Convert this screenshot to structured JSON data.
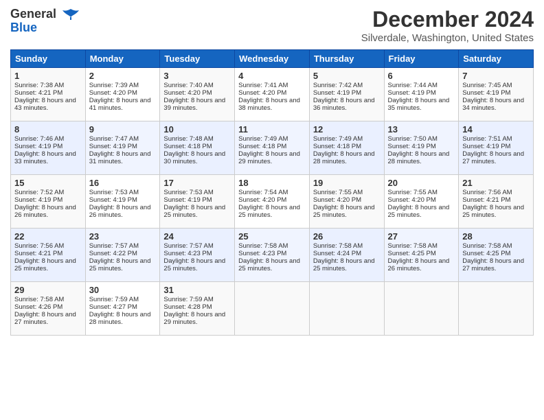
{
  "header": {
    "logo_line1": "General",
    "logo_line2": "Blue",
    "month": "December 2024",
    "location": "Silverdale, Washington, United States"
  },
  "days_of_week": [
    "Sunday",
    "Monday",
    "Tuesday",
    "Wednesday",
    "Thursday",
    "Friday",
    "Saturday"
  ],
  "weeks": [
    [
      {
        "day": "1",
        "sunrise": "Sunrise: 7:38 AM",
        "sunset": "Sunset: 4:21 PM",
        "daylight": "Daylight: 8 hours and 43 minutes."
      },
      {
        "day": "2",
        "sunrise": "Sunrise: 7:39 AM",
        "sunset": "Sunset: 4:20 PM",
        "daylight": "Daylight: 8 hours and 41 minutes."
      },
      {
        "day": "3",
        "sunrise": "Sunrise: 7:40 AM",
        "sunset": "Sunset: 4:20 PM",
        "daylight": "Daylight: 8 hours and 39 minutes."
      },
      {
        "day": "4",
        "sunrise": "Sunrise: 7:41 AM",
        "sunset": "Sunset: 4:20 PM",
        "daylight": "Daylight: 8 hours and 38 minutes."
      },
      {
        "day": "5",
        "sunrise": "Sunrise: 7:42 AM",
        "sunset": "Sunset: 4:19 PM",
        "daylight": "Daylight: 8 hours and 36 minutes."
      },
      {
        "day": "6",
        "sunrise": "Sunrise: 7:44 AM",
        "sunset": "Sunset: 4:19 PM",
        "daylight": "Daylight: 8 hours and 35 minutes."
      },
      {
        "day": "7",
        "sunrise": "Sunrise: 7:45 AM",
        "sunset": "Sunset: 4:19 PM",
        "daylight": "Daylight: 8 hours and 34 minutes."
      }
    ],
    [
      {
        "day": "8",
        "sunrise": "Sunrise: 7:46 AM",
        "sunset": "Sunset: 4:19 PM",
        "daylight": "Daylight: 8 hours and 33 minutes."
      },
      {
        "day": "9",
        "sunrise": "Sunrise: 7:47 AM",
        "sunset": "Sunset: 4:19 PM",
        "daylight": "Daylight: 8 hours and 31 minutes."
      },
      {
        "day": "10",
        "sunrise": "Sunrise: 7:48 AM",
        "sunset": "Sunset: 4:18 PM",
        "daylight": "Daylight: 8 hours and 30 minutes."
      },
      {
        "day": "11",
        "sunrise": "Sunrise: 7:49 AM",
        "sunset": "Sunset: 4:18 PM",
        "daylight": "Daylight: 8 hours and 29 minutes."
      },
      {
        "day": "12",
        "sunrise": "Sunrise: 7:49 AM",
        "sunset": "Sunset: 4:18 PM",
        "daylight": "Daylight: 8 hours and 28 minutes."
      },
      {
        "day": "13",
        "sunrise": "Sunrise: 7:50 AM",
        "sunset": "Sunset: 4:19 PM",
        "daylight": "Daylight: 8 hours and 28 minutes."
      },
      {
        "day": "14",
        "sunrise": "Sunrise: 7:51 AM",
        "sunset": "Sunset: 4:19 PM",
        "daylight": "Daylight: 8 hours and 27 minutes."
      }
    ],
    [
      {
        "day": "15",
        "sunrise": "Sunrise: 7:52 AM",
        "sunset": "Sunset: 4:19 PM",
        "daylight": "Daylight: 8 hours and 26 minutes."
      },
      {
        "day": "16",
        "sunrise": "Sunrise: 7:53 AM",
        "sunset": "Sunset: 4:19 PM",
        "daylight": "Daylight: 8 hours and 26 minutes."
      },
      {
        "day": "17",
        "sunrise": "Sunrise: 7:53 AM",
        "sunset": "Sunset: 4:19 PM",
        "daylight": "Daylight: 8 hours and 25 minutes."
      },
      {
        "day": "18",
        "sunrise": "Sunrise: 7:54 AM",
        "sunset": "Sunset: 4:20 PM",
        "daylight": "Daylight: 8 hours and 25 minutes."
      },
      {
        "day": "19",
        "sunrise": "Sunrise: 7:55 AM",
        "sunset": "Sunset: 4:20 PM",
        "daylight": "Daylight: 8 hours and 25 minutes."
      },
      {
        "day": "20",
        "sunrise": "Sunrise: 7:55 AM",
        "sunset": "Sunset: 4:20 PM",
        "daylight": "Daylight: 8 hours and 25 minutes."
      },
      {
        "day": "21",
        "sunrise": "Sunrise: 7:56 AM",
        "sunset": "Sunset: 4:21 PM",
        "daylight": "Daylight: 8 hours and 25 minutes."
      }
    ],
    [
      {
        "day": "22",
        "sunrise": "Sunrise: 7:56 AM",
        "sunset": "Sunset: 4:21 PM",
        "daylight": "Daylight: 8 hours and 25 minutes."
      },
      {
        "day": "23",
        "sunrise": "Sunrise: 7:57 AM",
        "sunset": "Sunset: 4:22 PM",
        "daylight": "Daylight: 8 hours and 25 minutes."
      },
      {
        "day": "24",
        "sunrise": "Sunrise: 7:57 AM",
        "sunset": "Sunset: 4:23 PM",
        "daylight": "Daylight: 8 hours and 25 minutes."
      },
      {
        "day": "25",
        "sunrise": "Sunrise: 7:58 AM",
        "sunset": "Sunset: 4:23 PM",
        "daylight": "Daylight: 8 hours and 25 minutes."
      },
      {
        "day": "26",
        "sunrise": "Sunrise: 7:58 AM",
        "sunset": "Sunset: 4:24 PM",
        "daylight": "Daylight: 8 hours and 25 minutes."
      },
      {
        "day": "27",
        "sunrise": "Sunrise: 7:58 AM",
        "sunset": "Sunset: 4:25 PM",
        "daylight": "Daylight: 8 hours and 26 minutes."
      },
      {
        "day": "28",
        "sunrise": "Sunrise: 7:58 AM",
        "sunset": "Sunset: 4:25 PM",
        "daylight": "Daylight: 8 hours and 27 minutes."
      }
    ],
    [
      {
        "day": "29",
        "sunrise": "Sunrise: 7:58 AM",
        "sunset": "Sunset: 4:26 PM",
        "daylight": "Daylight: 8 hours and 27 minutes."
      },
      {
        "day": "30",
        "sunrise": "Sunrise: 7:59 AM",
        "sunset": "Sunset: 4:27 PM",
        "daylight": "Daylight: 8 hours and 28 minutes."
      },
      {
        "day": "31",
        "sunrise": "Sunrise: 7:59 AM",
        "sunset": "Sunset: 4:28 PM",
        "daylight": "Daylight: 8 hours and 29 minutes."
      },
      {
        "day": "",
        "sunrise": "",
        "sunset": "",
        "daylight": ""
      },
      {
        "day": "",
        "sunrise": "",
        "sunset": "",
        "daylight": ""
      },
      {
        "day": "",
        "sunrise": "",
        "sunset": "",
        "daylight": ""
      },
      {
        "day": "",
        "sunrise": "",
        "sunset": "",
        "daylight": ""
      }
    ]
  ]
}
